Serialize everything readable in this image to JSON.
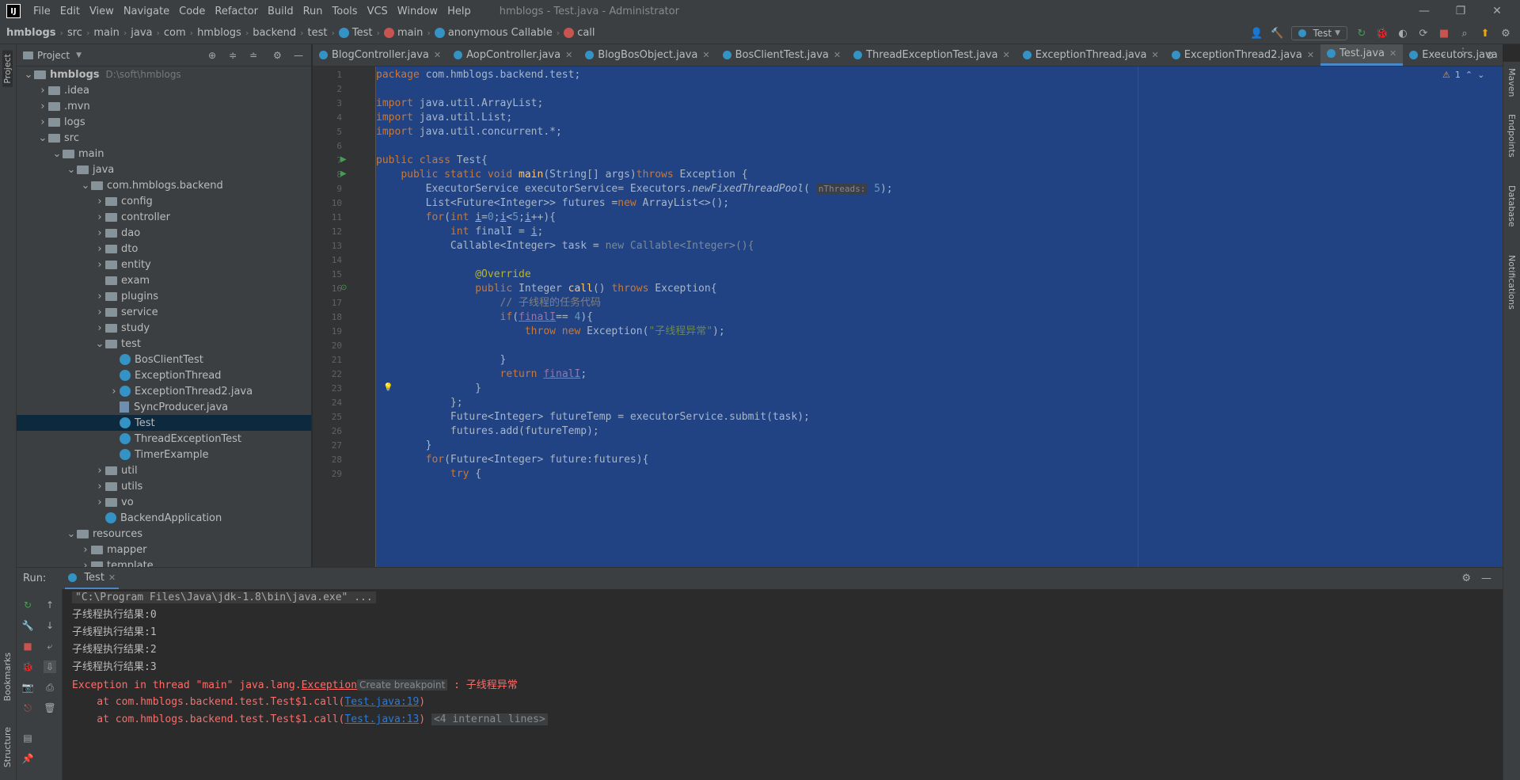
{
  "window": {
    "app_logo": "IJ",
    "title": "hmblogs - Test.java - Administrator",
    "minimize": "—",
    "maximize": "❐",
    "close": "✕"
  },
  "menu": [
    "File",
    "Edit",
    "View",
    "Navigate",
    "Code",
    "Refactor",
    "Build",
    "Run",
    "Tools",
    "VCS",
    "Window",
    "Help"
  ],
  "breadcrumb": [
    "hmblogs",
    "src",
    "main",
    "java",
    "com",
    "hmblogs",
    "backend",
    "test",
    "Test",
    "main",
    "anonymous Callable",
    "call"
  ],
  "toolbar": {
    "run_config": "Test"
  },
  "project_panel": {
    "title": "Project",
    "tree": [
      {
        "label": "hmblogs",
        "hint": "D:\\soft\\hmblogs",
        "type": "folder",
        "depth": 0,
        "expanded": true
      },
      {
        "label": ".idea",
        "type": "folder",
        "depth": 1,
        "expanded": false
      },
      {
        "label": ".mvn",
        "type": "folder",
        "depth": 1,
        "expanded": false
      },
      {
        "label": "logs",
        "type": "folder",
        "depth": 1,
        "expanded": false
      },
      {
        "label": "src",
        "type": "folder",
        "depth": 1,
        "expanded": true
      },
      {
        "label": "main",
        "type": "folder",
        "depth": 2,
        "expanded": true
      },
      {
        "label": "java",
        "type": "folder",
        "depth": 3,
        "expanded": true
      },
      {
        "label": "com.hmblogs.backend",
        "type": "folder",
        "depth": 4,
        "expanded": true
      },
      {
        "label": "config",
        "type": "folder",
        "depth": 5,
        "expanded": false
      },
      {
        "label": "controller",
        "type": "folder",
        "depth": 5,
        "expanded": false
      },
      {
        "label": "dao",
        "type": "folder",
        "depth": 5,
        "expanded": false
      },
      {
        "label": "dto",
        "type": "folder",
        "depth": 5,
        "expanded": false
      },
      {
        "label": "entity",
        "type": "folder",
        "depth": 5,
        "expanded": false
      },
      {
        "label": "exam",
        "type": "folder",
        "depth": 5,
        "leaf": true
      },
      {
        "label": "plugins",
        "type": "folder",
        "depth": 5,
        "expanded": false
      },
      {
        "label": "service",
        "type": "folder",
        "depth": 5,
        "expanded": false
      },
      {
        "label": "study",
        "type": "folder",
        "depth": 5,
        "expanded": false
      },
      {
        "label": "test",
        "type": "folder",
        "depth": 5,
        "expanded": true
      },
      {
        "label": "BosClientTest",
        "type": "class",
        "depth": 6,
        "leaf": true
      },
      {
        "label": "ExceptionThread",
        "type": "class",
        "depth": 6,
        "leaf": true
      },
      {
        "label": "ExceptionThread2.java",
        "type": "class",
        "depth": 6,
        "expanded": false
      },
      {
        "label": "SyncProducer.java",
        "type": "file",
        "depth": 6,
        "leaf": true
      },
      {
        "label": "Test",
        "type": "class",
        "depth": 6,
        "leaf": true,
        "selected": true
      },
      {
        "label": "ThreadExceptionTest",
        "type": "class",
        "depth": 6,
        "leaf": true
      },
      {
        "label": "TimerExample",
        "type": "class",
        "depth": 6,
        "leaf": true
      },
      {
        "label": "util",
        "type": "folder",
        "depth": 5,
        "expanded": false
      },
      {
        "label": "utils",
        "type": "folder",
        "depth": 5,
        "expanded": false
      },
      {
        "label": "vo",
        "type": "folder",
        "depth": 5,
        "expanded": false
      },
      {
        "label": "BackendApplication",
        "type": "class",
        "depth": 5,
        "leaf": true
      },
      {
        "label": "resources",
        "type": "folder",
        "depth": 3,
        "expanded": true
      },
      {
        "label": "mapper",
        "type": "folder",
        "depth": 4,
        "expanded": false
      },
      {
        "label": "template",
        "type": "folder",
        "depth": 4,
        "expanded": false
      }
    ]
  },
  "editor_tabs": [
    {
      "label": "BlogController.java",
      "active": false
    },
    {
      "label": "AopController.java",
      "active": false
    },
    {
      "label": "BlogBosObject.java",
      "active": false
    },
    {
      "label": "BosClientTest.java",
      "active": false
    },
    {
      "label": "ThreadExceptionTest.java",
      "active": false
    },
    {
      "label": "ExceptionThread.java",
      "active": false
    },
    {
      "label": "ExceptionThread2.java",
      "active": false
    },
    {
      "label": "Test.java",
      "active": true
    },
    {
      "label": "Executors.java",
      "active": false
    }
  ],
  "editor": {
    "warning_count": "1",
    "line_numbers": [
      "1",
      "2",
      "3",
      "4",
      "5",
      "6",
      "7",
      "8",
      "9",
      "10",
      "11",
      "12",
      "13",
      "14",
      "15",
      "16",
      "17",
      "18",
      "19",
      "20",
      "21",
      "22",
      "23",
      "24",
      "25",
      "26",
      "27",
      "28",
      "29"
    ]
  },
  "right_stripe": [
    "Maven",
    "Endpoints",
    "Database",
    "Notifications"
  ],
  "left_stripe": [
    "Project",
    "Bookmarks",
    "Structure"
  ],
  "run_panel": {
    "label": "Run:",
    "tab": "Test",
    "console": {
      "cmd": "\"C:\\Program Files\\Java\\jdk-1.8\\bin\\java.exe\" ...",
      "results": [
        "子线程执行结果:0",
        "子线程执行结果:1",
        "子线程执行结果:2",
        "子线程执行结果:3"
      ],
      "exception_prefix": "Exception in thread \"main\" java.lang.",
      "exception_class": "Exception",
      "create_breakpoint": "Create breakpoint",
      "exception_msg": ": 子线程异常",
      "trace1_prefix": "    at com.hmblogs.backend.test.Test$1.call(",
      "trace1_link": "Test.java:19",
      "trace1_suffix": ")",
      "trace2_prefix": "    at com.hmblogs.backend.test.Test$1.call(",
      "trace2_link": "Test.java:13",
      "trace2_suffix": ")",
      "internal_lines": "<4 internal lines>"
    }
  },
  "colors": {
    "selection": "#214283",
    "panel": "#3c3f41",
    "editor_bg": "#2b2b2b",
    "keyword": "#cc7832",
    "string": "#6a8759",
    "error": "#ff6b68",
    "link": "#287bde"
  }
}
